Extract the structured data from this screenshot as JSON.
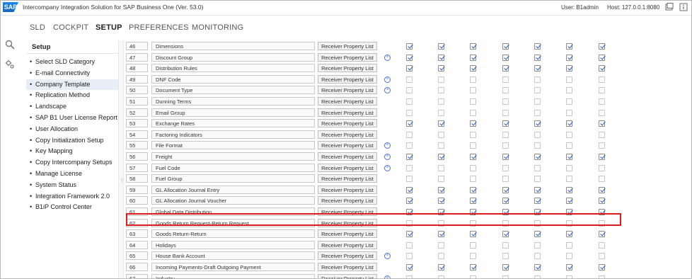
{
  "app": {
    "logo": "SAP",
    "title": "Intercompany Integration Solution for SAP Business One (Ver. 53.0)",
    "user": "User: B1admin",
    "host": "Host: 127.0.0.1:8080"
  },
  "toolbar_icons": [
    "window-icon",
    "info-icon"
  ],
  "nav_tabs": [
    {
      "label": "SLD",
      "active": false
    },
    {
      "label": "COCKPIT",
      "active": false
    },
    {
      "label": "SETUP",
      "active": true
    },
    {
      "label": "PREFERENCES",
      "active": false
    },
    {
      "label": "MONITORING",
      "active": false
    }
  ],
  "left_icons": [
    "search-icon",
    "settings-icon"
  ],
  "sidebar": {
    "title": "Setup",
    "items": [
      {
        "label": "Select SLD Category",
        "selected": false
      },
      {
        "label": "E-mail Connectivity",
        "selected": false
      },
      {
        "label": "Company Template",
        "selected": true
      },
      {
        "label": "Replication Method",
        "selected": false
      },
      {
        "label": "Landscape",
        "selected": false
      },
      {
        "label": "SAP B1 User License Report",
        "selected": false
      },
      {
        "label": "User Allocation",
        "selected": false
      },
      {
        "label": "Copy Initialization Setup",
        "selected": false
      },
      {
        "label": "Key Mapping",
        "selected": false
      },
      {
        "label": "Copy Intercompany Setups",
        "selected": false
      },
      {
        "label": "Manage License",
        "selected": false
      },
      {
        "label": "System Status",
        "selected": false
      },
      {
        "label": "Integration Framework 2.0",
        "selected": false
      },
      {
        "label": "B1iP Control Center",
        "selected": false
      }
    ]
  },
  "grid": {
    "button_label": "Receiver Property List",
    "rows": [
      {
        "num": "46",
        "name": "Dimensions",
        "x": false,
        "checks": [
          true,
          true,
          true,
          true,
          true,
          true,
          true
        ]
      },
      {
        "num": "47",
        "name": "Discount Group",
        "x": true,
        "checks": [
          true,
          true,
          true,
          true,
          true,
          true,
          true
        ]
      },
      {
        "num": "48",
        "name": "Distribution Rules",
        "x": false,
        "checks": [
          true,
          true,
          true,
          true,
          true,
          true,
          true
        ]
      },
      {
        "num": "49",
        "name": "DNF Code",
        "x": true,
        "checks": [
          false,
          false,
          false,
          false,
          false,
          false,
          false
        ]
      },
      {
        "num": "50",
        "name": "Document Type",
        "x": true,
        "checks": [
          false,
          false,
          false,
          false,
          false,
          false,
          false
        ]
      },
      {
        "num": "51",
        "name": "Dunning Terms",
        "x": false,
        "checks": [
          false,
          false,
          false,
          false,
          false,
          false,
          false
        ]
      },
      {
        "num": "52",
        "name": "Email Group",
        "x": false,
        "checks": [
          false,
          false,
          false,
          false,
          false,
          false,
          false
        ]
      },
      {
        "num": "53",
        "name": "Exchange Rates",
        "x": false,
        "checks": [
          true,
          true,
          true,
          true,
          true,
          true,
          true
        ]
      },
      {
        "num": "54",
        "name": "Factoring Indicators",
        "x": false,
        "checks": [
          false,
          false,
          false,
          false,
          false,
          false,
          false
        ]
      },
      {
        "num": "55",
        "name": "File Format",
        "x": true,
        "checks": [
          false,
          false,
          false,
          false,
          false,
          false,
          false
        ]
      },
      {
        "num": "56",
        "name": "Freight",
        "x": true,
        "checks": [
          true,
          true,
          true,
          true,
          true,
          true,
          true
        ]
      },
      {
        "num": "57",
        "name": "Fuel Code",
        "x": true,
        "checks": [
          false,
          false,
          false,
          false,
          false,
          false,
          false
        ]
      },
      {
        "num": "58",
        "name": "Fuel Group",
        "x": false,
        "checks": [
          false,
          false,
          false,
          false,
          false,
          false,
          false
        ]
      },
      {
        "num": "59",
        "name": "GL Allocation Journal Entry",
        "x": false,
        "checks": [
          true,
          true,
          true,
          true,
          true,
          true,
          true
        ]
      },
      {
        "num": "60",
        "name": "GL Allocation Journal Voucher",
        "x": false,
        "checks": [
          true,
          true,
          true,
          true,
          true,
          true,
          true
        ]
      },
      {
        "num": "61",
        "name": "Global Data Distribution",
        "x": false,
        "checks": [
          true,
          true,
          true,
          true,
          true,
          true,
          true
        ]
      },
      {
        "num": "62",
        "name": "Goods Return Request-Return Request",
        "x": false,
        "checks": [
          false,
          false,
          false,
          false,
          false,
          false,
          false
        ]
      },
      {
        "num": "63",
        "name": "Goods Return-Return",
        "x": false,
        "checks": [
          true,
          true,
          true,
          true,
          true,
          true,
          true
        ]
      },
      {
        "num": "64",
        "name": "Holidays",
        "x": false,
        "checks": [
          false,
          false,
          false,
          false,
          false,
          false,
          false
        ]
      },
      {
        "num": "65",
        "name": "House Bank Account",
        "x": true,
        "checks": [
          false,
          false,
          false,
          false,
          false,
          false,
          false
        ]
      },
      {
        "num": "66",
        "name": "Incoming Payments-Draft Outgoing Payment",
        "x": false,
        "checks": [
          true,
          true,
          true,
          true,
          true,
          true,
          true
        ]
      },
      {
        "num": "67",
        "name": "Industry",
        "x": true,
        "checks": [
          false,
          false,
          false,
          false,
          false,
          false,
          false
        ]
      }
    ]
  },
  "colors": {
    "check": "#2458c9",
    "highlight_border": "#e01b1b",
    "remove_icon": "#4a6fd6",
    "selected_bg": "#e8eef5"
  }
}
